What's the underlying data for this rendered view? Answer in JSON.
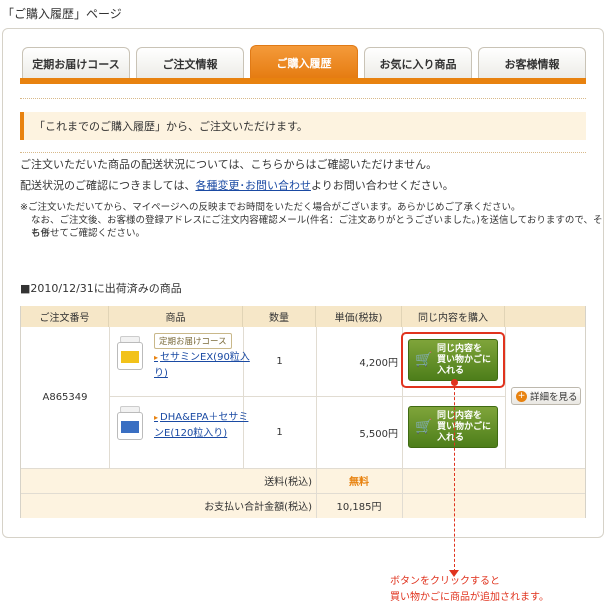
{
  "page_caption": "「ご購入履歴」ページ",
  "tabs": [
    {
      "label": "定期お届けコース",
      "active": false
    },
    {
      "label": "ご注文情報",
      "active": false
    },
    {
      "label": "ご購入履歴",
      "active": true
    },
    {
      "label": "お気に入り商品",
      "active": false
    },
    {
      "label": "お客様情報",
      "active": false
    }
  ],
  "notice": "「これまでのご購入履歴」から、ご注文いただけます。",
  "intro": {
    "line1": "ご注文いただいた商品の配送状況については、こちらからはご確認いただけません。",
    "line2_before": "配送状況のご確認につきましては、",
    "line2_link": "各種変更･お問い合わせ",
    "line2_after": "よりお問い合わせください。"
  },
  "note": {
    "line1": "※ご注文いただいてから、マイページへの反映までお時間をいただく場合がございます。あらかじめご了承ください。",
    "line2": "なお、ご注文後、お客様の登録アドレスにご注文内容確認メール(件名：ご注文ありがとうございました。)を送信しておりますので、そちら",
    "line3": "も併せてご確認ください。"
  },
  "section_title": "■2010/12/31に出荷済みの商品",
  "table": {
    "headers": [
      "ご注文番号",
      "商品",
      "数量",
      "単価(税抜)",
      "同じ内容を購入"
    ],
    "order_number": "A865349",
    "items": [
      {
        "tag": "定期お届けコース",
        "name_line1": "セサミンEX(90粒入",
        "name_line2": "り)",
        "qty": "1",
        "price": "4,200円",
        "bottle_color": "#f2c21a"
      },
      {
        "tag": "",
        "name_line1": "DHA&EPA＋セサミ",
        "name_line2": "ンE(120粒入り)",
        "qty": "1",
        "price": "5,500円",
        "bottle_color": "#3a6fc2"
      }
    ],
    "buy_button_line1": "同じ内容を",
    "buy_button_line2": "買い物かごに",
    "buy_button_line3": "入れる",
    "detail_button": "詳細を見る",
    "shipping_label": "送料(税込)",
    "shipping_value": "無料",
    "total_label": "お支払い合計金額(税込)",
    "total_value": "10,185円"
  },
  "callout": {
    "line1": "ボタンをクリックすると",
    "line2": "買い物かごに商品が追加されます。"
  },
  "colors": {
    "accent": "#e8820f",
    "button_green": "#5a8a22",
    "link": "#1a4aa3",
    "callout_red": "#e0331e",
    "header_bg": "#f6e7c8"
  }
}
